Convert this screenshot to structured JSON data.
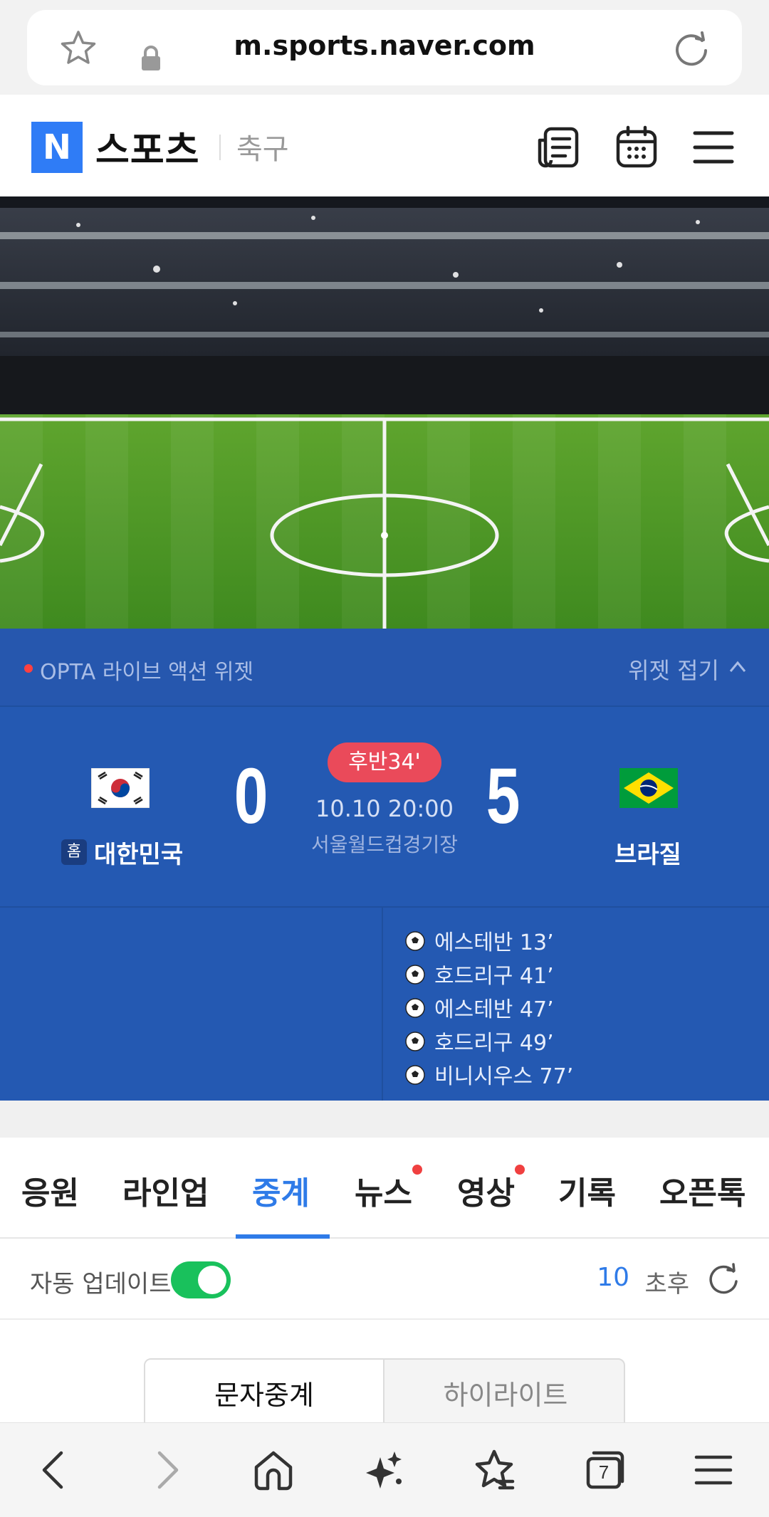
{
  "browser": {
    "url": "m.sports.naver.com",
    "tab_count": "7"
  },
  "header": {
    "logo_letter": "N",
    "brand": "스포츠",
    "category": "축구"
  },
  "widget": {
    "title": "OPTA 라이브 액션 위젯",
    "fold_label": "위젯 접기",
    "home_badge": "홈",
    "home_team": "대한민국",
    "away_team": "브라질",
    "home_score": "0",
    "away_score": "5",
    "status": "후반34'",
    "datetime": "10.10 20:00",
    "venue": "서울월드컵경기장",
    "goals": [
      {
        "text": "에스테반 13’"
      },
      {
        "text": "호드리구 41’"
      },
      {
        "text": "에스테반 47’"
      },
      {
        "text": "호드리구 49’"
      },
      {
        "text": "비니시우스 77’"
      }
    ]
  },
  "tabs": [
    {
      "label": "응원"
    },
    {
      "label": "라인업"
    },
    {
      "label": "중계"
    },
    {
      "label": "뉴스"
    },
    {
      "label": "영상"
    },
    {
      "label": "기록"
    },
    {
      "label": "오픈톡"
    }
  ],
  "auto_update": {
    "label": "자동 업데이트",
    "enabled": true,
    "countdown": "10",
    "countdown_unit": "초후"
  },
  "segment": {
    "option1": "문자중계",
    "option2": "하이라이트"
  },
  "colors": {
    "accent": "#2f7be8",
    "widget_bg": "#2459b2",
    "live_pill": "#ea4a5a",
    "toggle_on": "#19c15c",
    "naver_blue": "#2f7cf6"
  },
  "icons": [
    "star-icon",
    "lock-icon",
    "reload-icon",
    "news-icon",
    "calendar-icon",
    "menu-icon",
    "chevron-up-icon",
    "soccer-ball-icon",
    "refresh-icon",
    "back-icon",
    "forward-icon",
    "home-icon",
    "sparkle-icon",
    "bookmark-icon",
    "tabs-icon"
  ]
}
